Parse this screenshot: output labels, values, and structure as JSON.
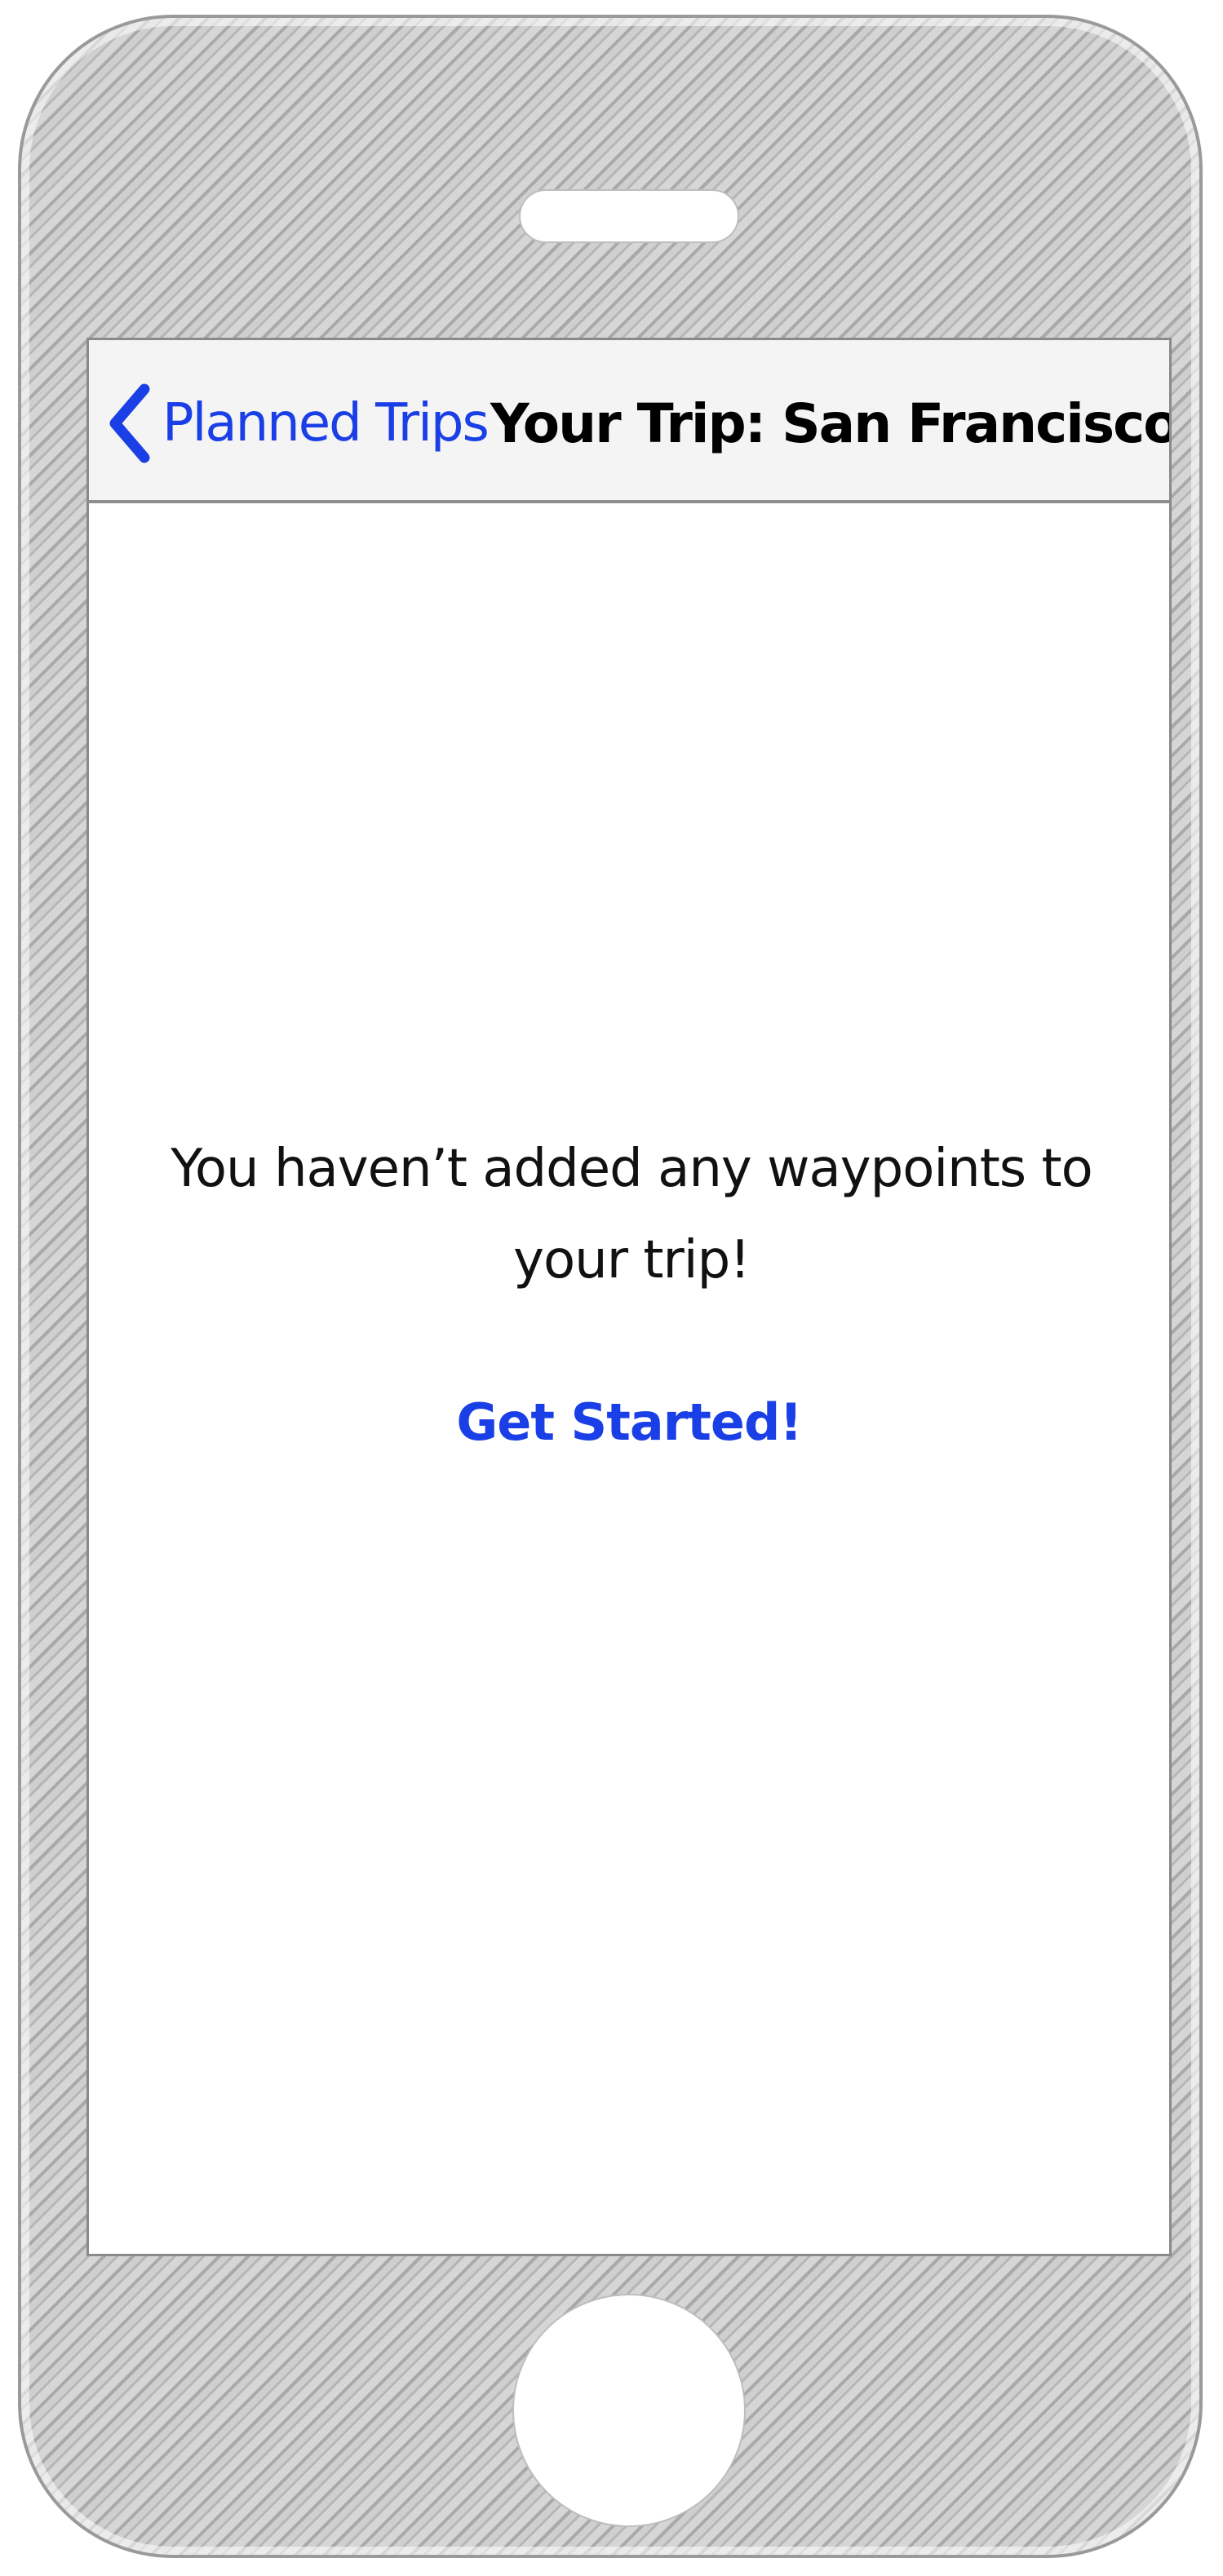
{
  "navbar": {
    "back_label": "Planned Trips",
    "title": "Your Trip: San Francisco"
  },
  "main": {
    "empty_message": "You haven’t added any waypoints to your trip!",
    "cta_label": "Get Started!"
  },
  "colors": {
    "accent": "#1a3fe6",
    "text": "#111111",
    "navbar_bg": "#f4f4f4",
    "frame": "#cfcfcf"
  },
  "icons": {
    "back": "chevron-left-icon"
  }
}
